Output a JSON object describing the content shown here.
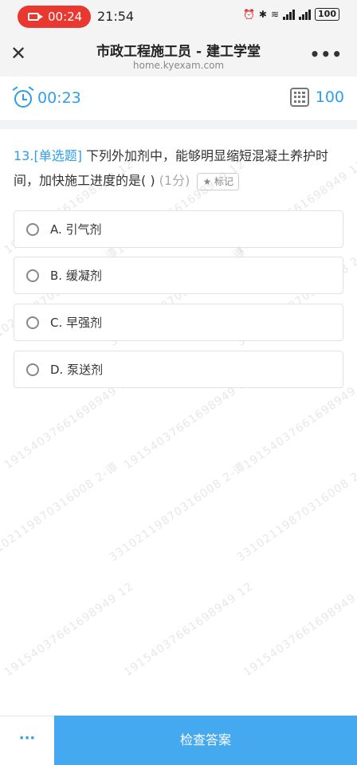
{
  "status_bar": {
    "rec_time": "00:24",
    "clock": "21:54",
    "battery": "100"
  },
  "nav": {
    "title": "市政工程施工员 - 建工学堂",
    "url": "home.kyexam.com",
    "close_icon": "close-icon",
    "more_icon": "more-icon"
  },
  "exam_bar": {
    "timer": "00:23",
    "count": "100"
  },
  "question": {
    "number": "13.",
    "type": "[单选题]",
    "text": "下列外加剂中，能够明显缩短混凝土养护时间，加快施工进度的是( )",
    "score": "(1分)",
    "mark_label": "标记"
  },
  "options": [
    {
      "label": "A. 引气剂"
    },
    {
      "label": "B. 缓凝剂"
    },
    {
      "label": "C. 早强剂"
    },
    {
      "label": "D. 泵送剂"
    }
  ],
  "watermark": {
    "line1": "19154037661698949 12",
    "line2": "33102119870316008 2-谭"
  },
  "bottom": {
    "more": "···",
    "check": "检查答案"
  },
  "colors": {
    "accent": "#2f9ee8",
    "button": "#45a9f0",
    "record": "#e8382f"
  }
}
